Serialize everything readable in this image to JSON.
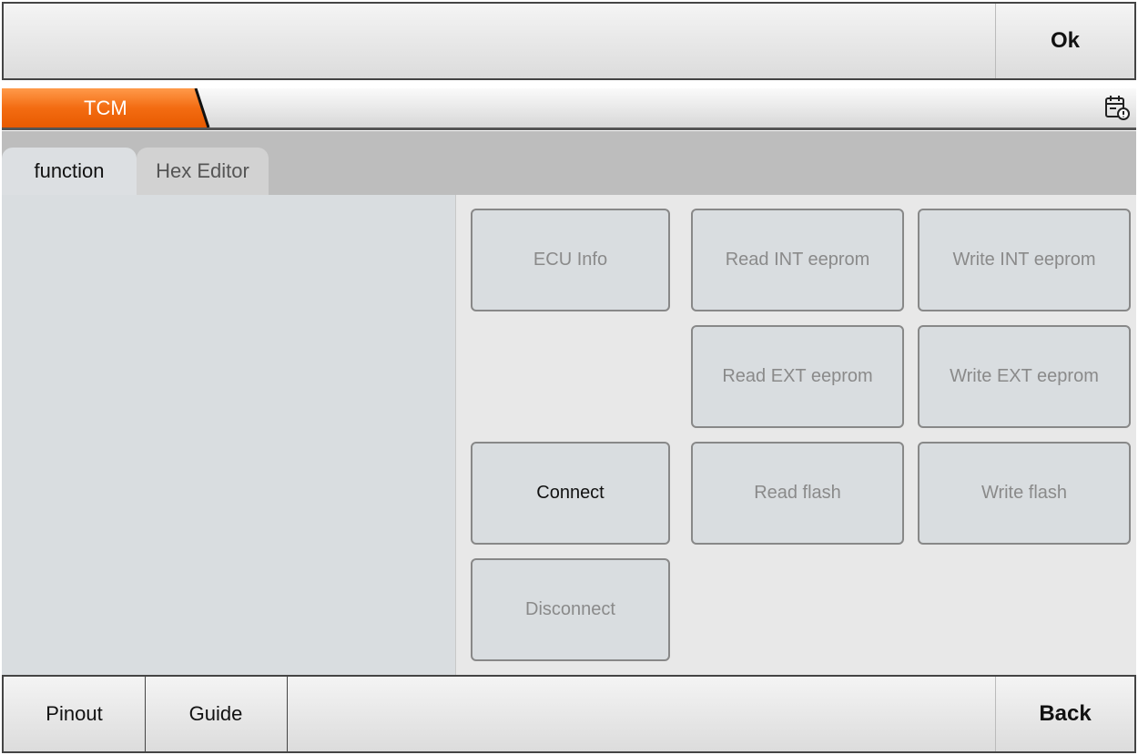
{
  "header": {
    "ok_label": "Ok"
  },
  "breadcrumb": {
    "label": "TCM",
    "accent_color": "#f36c12",
    "icon": "calendar-warning-icon"
  },
  "tabs": [
    {
      "label": "function",
      "active": true
    },
    {
      "label": "Hex Editor",
      "active": false
    }
  ],
  "functions": {
    "ecu_info": "ECU Info",
    "read_int": "Read INT eeprom",
    "write_int": "Write INT eeprom",
    "read_ext": "Read EXT eeprom",
    "write_ext": "Write EXT eeprom",
    "connect": "Connect",
    "read_flash": "Read flash",
    "write_flash": "Write flash",
    "disconnect": "Disconnect"
  },
  "footer": {
    "pinout_label": "Pinout",
    "guide_label": "Guide",
    "back_label": "Back"
  }
}
